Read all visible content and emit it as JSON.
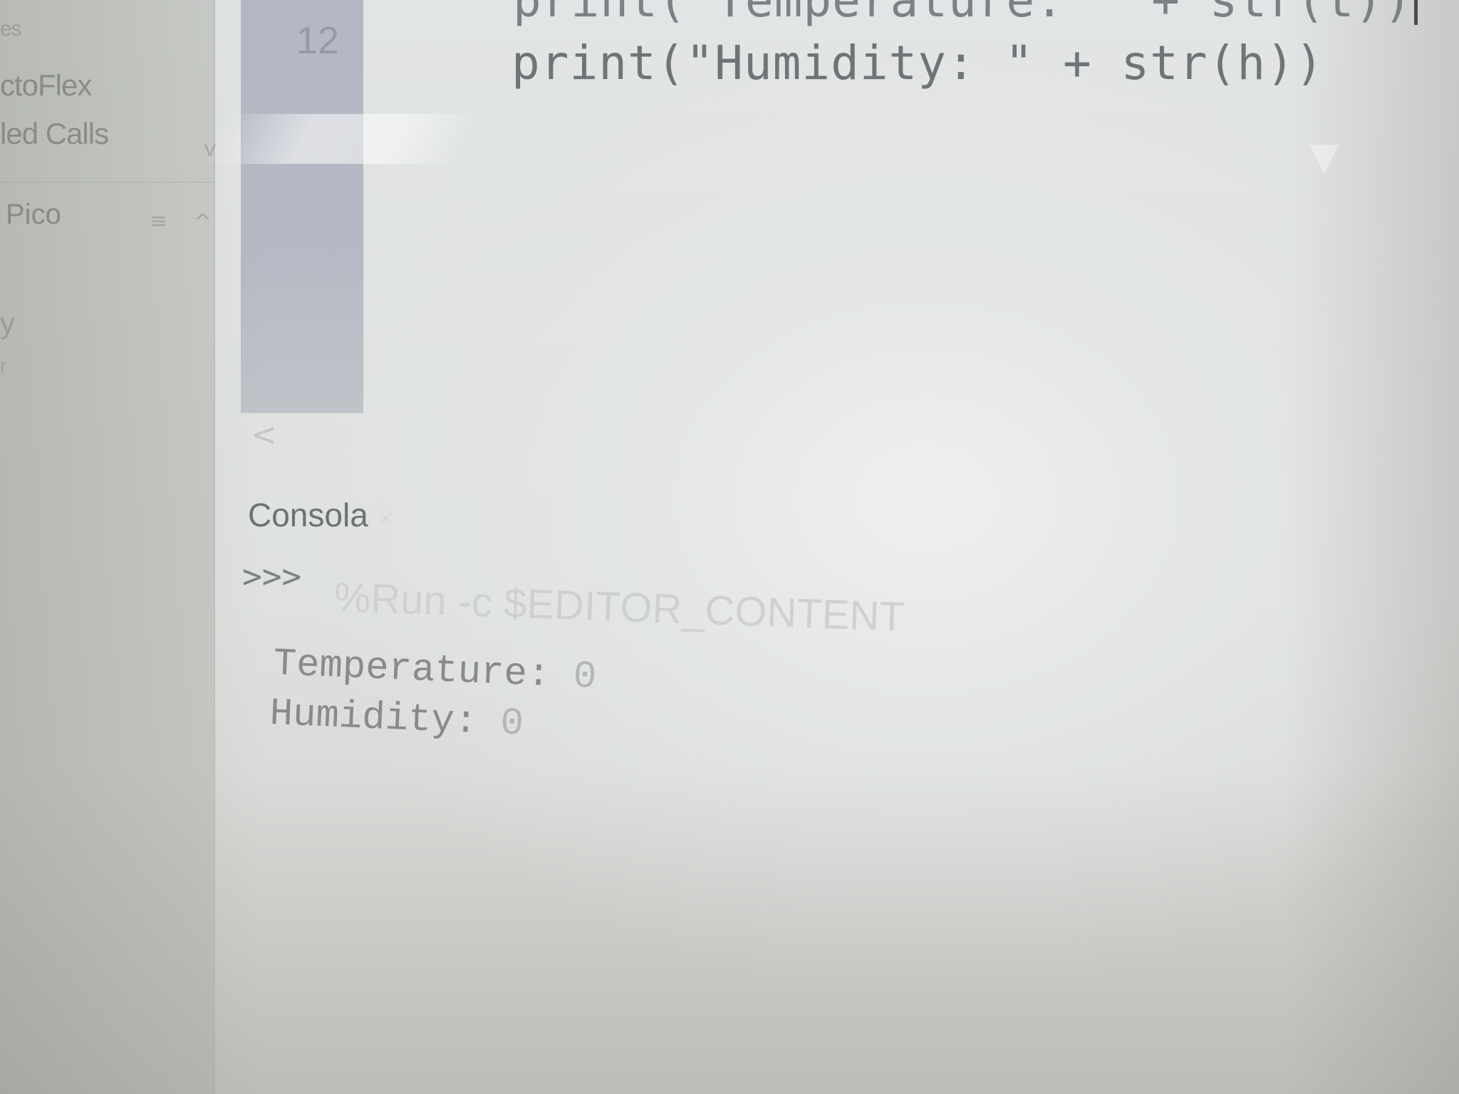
{
  "sidebar": {
    "items": [
      {
        "label": "es"
      },
      {
        "label": "ctoFlex"
      },
      {
        "label": "led Calls"
      }
    ],
    "section": {
      "label": "Pico",
      "menu_icon": "≡",
      "collapse_icon": "^"
    },
    "partial": [
      {
        "label": "y"
      },
      {
        "label": "r"
      }
    ],
    "chevron": "v"
  },
  "editor": {
    "line_number": "12",
    "lines": [
      "print(\"Temperature: \" + str(t))",
      "print(\"Humidity: \" + str(h))"
    ]
  },
  "console": {
    "tab_label": "Consola",
    "prompt": ">>>",
    "command": "%Run -c $EDITOR_CONTENT",
    "output": [
      {
        "label": "Temperature: ",
        "value": "0"
      },
      {
        "label": "Humidity: ",
        "value": "0"
      }
    ]
  },
  "colors": {
    "gutter": "#b3b8c4",
    "code_text": "#6e7578",
    "console_text": "#888b88"
  }
}
